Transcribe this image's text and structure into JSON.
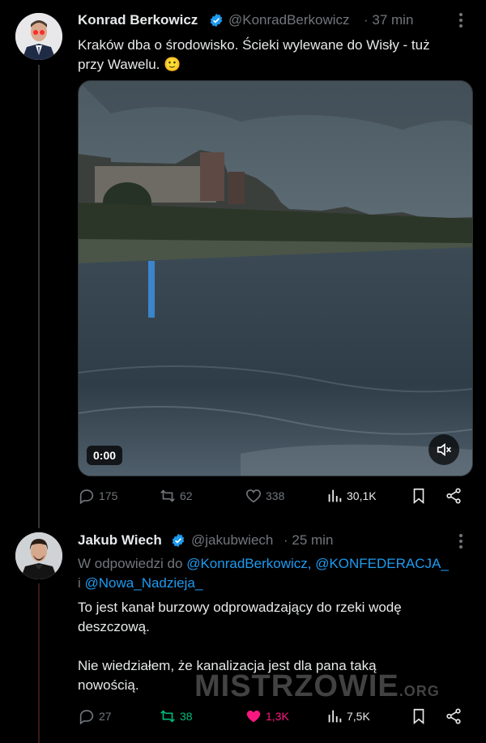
{
  "tweet1": {
    "name": "Konrad Berkowicz",
    "handle": "@KonradBerkowicz",
    "time": "· 37 min",
    "text_line1": "Kraków dba o środowisko. Ścieki wylewane do Wisły - tuż",
    "text_line2": "przy Wawelu. 🙂",
    "video_time": "0:00",
    "replies": "175",
    "reposts": "62",
    "likes": "338",
    "views": "30,1K"
  },
  "tweet2": {
    "name": "Jakub Wiech",
    "handle": "@jakubwiech",
    "time": "· 25 min",
    "reply_prefix": "W odpowiedzi do",
    "mention1": "@KonradBerkowicz,",
    "mention2": "@KONFEDERACJA_",
    "reply_and": "i",
    "mention3": "@Nowa_Nadzieja_",
    "text_line1": "To jest kanał burzowy odprowadzający do rzeki wodę",
    "text_line2": "deszczową.",
    "text_line3": "Nie wiedziałem, że kanalizacja jest dla pana taką",
    "text_line4": "nowością.",
    "replies": "27",
    "reposts": "38",
    "likes": "1,3K",
    "views": "7,5K"
  },
  "watermark": {
    "main": "MISTRZOWIE",
    "suffix": ".ORG"
  },
  "colors": {
    "accent": "#1d9bf0",
    "repost_active": "#00ba7c",
    "like_active": "#f91880",
    "muted": "#71767b"
  }
}
